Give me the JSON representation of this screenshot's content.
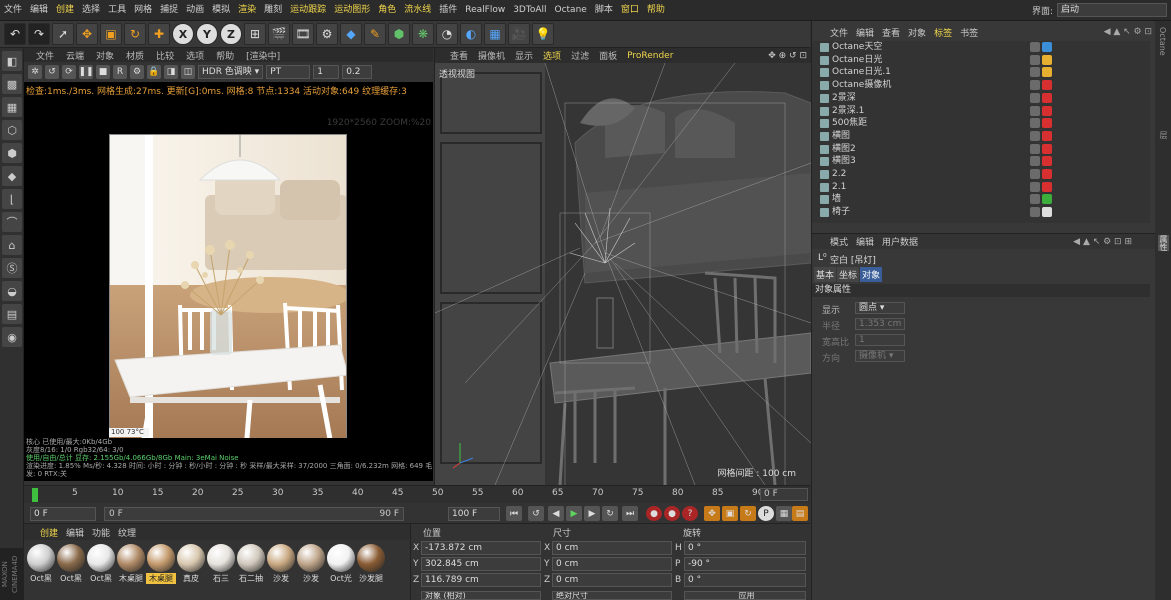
{
  "menubar": {
    "items": [
      {
        "label": "文件"
      },
      {
        "label": "编辑"
      },
      {
        "label": "创建",
        "hl": true
      },
      {
        "label": "选择"
      },
      {
        "label": "工具"
      },
      {
        "label": "网格"
      },
      {
        "label": "捕捉"
      },
      {
        "label": "动画"
      },
      {
        "label": "模拟"
      },
      {
        "label": "渲染",
        "hl": true
      },
      {
        "label": "雕刻"
      },
      {
        "label": "运动跟踪",
        "hl": true
      },
      {
        "label": "运动图形",
        "hl": true
      },
      {
        "label": "角色",
        "hl": true
      },
      {
        "label": "流水线",
        "hl": true
      },
      {
        "label": "插件"
      },
      {
        "label": "RealFlow"
      },
      {
        "label": "3DToAll"
      },
      {
        "label": "Octane"
      },
      {
        "label": "脚本"
      },
      {
        "label": "窗口",
        "hl": true
      },
      {
        "label": "帮助",
        "hl": true
      }
    ],
    "layout_label": "界面:",
    "layout_value": "启动"
  },
  "octane": {
    "menu": [
      "文件",
      "云端",
      "对象",
      "材质",
      "比较",
      "选项",
      "帮助"
    ],
    "render_state": "[渲染中]",
    "tonemap": "HDR 色调映 ▾",
    "mode": "PT",
    "val1": "1",
    "val2": "0.2",
    "status": "检查:1ms./3ms. 网格生成:27ms. 更新[G]:0ms. 网格:8 节点:1334 活动对象:649 纹理缓存:3",
    "zoom": "1920*2560 ZOOM:%20",
    "badge": "100   73°C",
    "info1": "核心 已使用/最大:0Kb/4Gb",
    "info2": "灰度8/16: 1/0              Rgb32/64: 3/0",
    "info3": "使用/自由/总计 显存: 2.155Gb/4.066Gb/8Gb    Main: 3eMai Noise",
    "info4": "渲染进度: 1.85%  Ms/秒: 4.328  时间: 小时 : 分钟 : 秒/小时 : 分钟 : 秒  采样/最大采样: 37/2000  三角面: 0/6.232m  网格: 649  毛发: 0  RTX:关"
  },
  "viewport": {
    "menu": [
      {
        "label": "查看"
      },
      {
        "label": "摄像机"
      },
      {
        "label": "显示"
      },
      {
        "label": "选项",
        "hl": true
      },
      {
        "label": "过滤"
      },
      {
        "label": "面板"
      },
      {
        "label": "ProRender",
        "hl": true
      }
    ],
    "label": "透视视图",
    "grid": "网格间距 : 100 cm"
  },
  "timeline": {
    "ticks": [
      "0",
      "5",
      "10",
      "15",
      "20",
      "25",
      "30",
      "35",
      "40",
      "45",
      "50",
      "55",
      "60",
      "65",
      "70",
      "75",
      "80",
      "85",
      "90"
    ],
    "frame": "0 F"
  },
  "transport": {
    "start": "0 F",
    "slider_start": "0 F",
    "slider_end": "90 F",
    "end": "100 F"
  },
  "materials": {
    "menu": [
      "创建",
      "编辑",
      "功能",
      "纹理"
    ],
    "items": [
      {
        "label": "Oct黑",
        "color": "#cfcfcf"
      },
      {
        "label": "Oct黑",
        "color": "#8a6a4a"
      },
      {
        "label": "Oct黑",
        "color": "#e8e8e8"
      },
      {
        "label": "木桌腿",
        "color": "#b08a66"
      },
      {
        "label": "木桌腿",
        "color": "#c49a6c",
        "sel": true
      },
      {
        "label": "真皮",
        "color": "#d8c7ae"
      },
      {
        "label": "石三",
        "color": "#e6e2dc"
      },
      {
        "label": "石二抽",
        "color": "#d0c8bc"
      },
      {
        "label": "沙发",
        "color": "#c9a982"
      },
      {
        "label": "沙发",
        "color": "#bfa58a"
      },
      {
        "label": "Oct光",
        "color": "#f2f2f2"
      },
      {
        "label": "沙发腿",
        "color": "#8a5c34"
      }
    ]
  },
  "coords": {
    "headers": [
      "位置",
      "尺寸",
      "旋转"
    ],
    "pos": [
      {
        "axis": "X",
        "value": "-173.872 cm"
      },
      {
        "axis": "Y",
        "value": "302.845 cm"
      },
      {
        "axis": "Z",
        "value": "116.789 cm"
      }
    ],
    "size": [
      {
        "axis": "X",
        "value": "0 cm"
      },
      {
        "axis": "Y",
        "value": "0 cm"
      },
      {
        "axis": "Z",
        "value": "0 cm"
      }
    ],
    "rot": [
      {
        "axis": "H",
        "value": "0 °"
      },
      {
        "axis": "P",
        "value": "-90 °"
      },
      {
        "axis": "B",
        "value": "0 °"
      }
    ],
    "mode1": "对象 (相对)",
    "mode2": "绝对尺寸",
    "apply": "应用"
  },
  "objects": {
    "menu": [
      {
        "label": "文件"
      },
      {
        "label": "编辑"
      },
      {
        "label": "查看"
      },
      {
        "label": "对象"
      },
      {
        "label": "标签",
        "hl": true
      },
      {
        "label": "书签"
      }
    ],
    "items": [
      {
        "name": "Octane天空",
        "tag": "#3b8fd8"
      },
      {
        "name": "Octane日光",
        "tag": "#e8b030"
      },
      {
        "name": "Octane日光.1",
        "tag": "#e8b030"
      },
      {
        "name": "Octane摄像机",
        "tag": "#d83030"
      },
      {
        "name": "2景深",
        "tag": "#d83030"
      },
      {
        "name": "2景深.1",
        "tag": "#d83030"
      },
      {
        "name": "500焦距",
        "tag": "#d83030"
      },
      {
        "name": "横图",
        "tag": "#d83030"
      },
      {
        "name": "横图2",
        "tag": "#d83030"
      },
      {
        "name": "横图3",
        "tag": "#d83030"
      },
      {
        "name": "2.2",
        "tag": "#d83030"
      },
      {
        "name": "2.1",
        "tag": "#d83030"
      },
      {
        "name": "墙",
        "tag": "#3cae3c"
      },
      {
        "name": "椅子",
        "tag": "#dddddd"
      }
    ]
  },
  "attributes": {
    "menu": [
      "模式",
      "编辑",
      "用户数据"
    ],
    "title": "空白 [吊灯]",
    "tabs": [
      {
        "label": "基本"
      },
      {
        "label": "坐标"
      },
      {
        "label": "对象",
        "act": true
      }
    ],
    "section": "对象属性",
    "rows": [
      {
        "label": "显示",
        "value": "圆点 ▾",
        "dim": false
      },
      {
        "label": "半径",
        "value": "1.353 cm",
        "dim": true
      },
      {
        "label": "宽高比",
        "value": "1",
        "dim": true
      },
      {
        "label": "方向",
        "value": "摄像机 ▾",
        "dim": true
      }
    ]
  },
  "side": {
    "t1": "Octane",
    "t2": "属性",
    "t3": "层"
  },
  "brand": "MAXON CINEMA4D"
}
